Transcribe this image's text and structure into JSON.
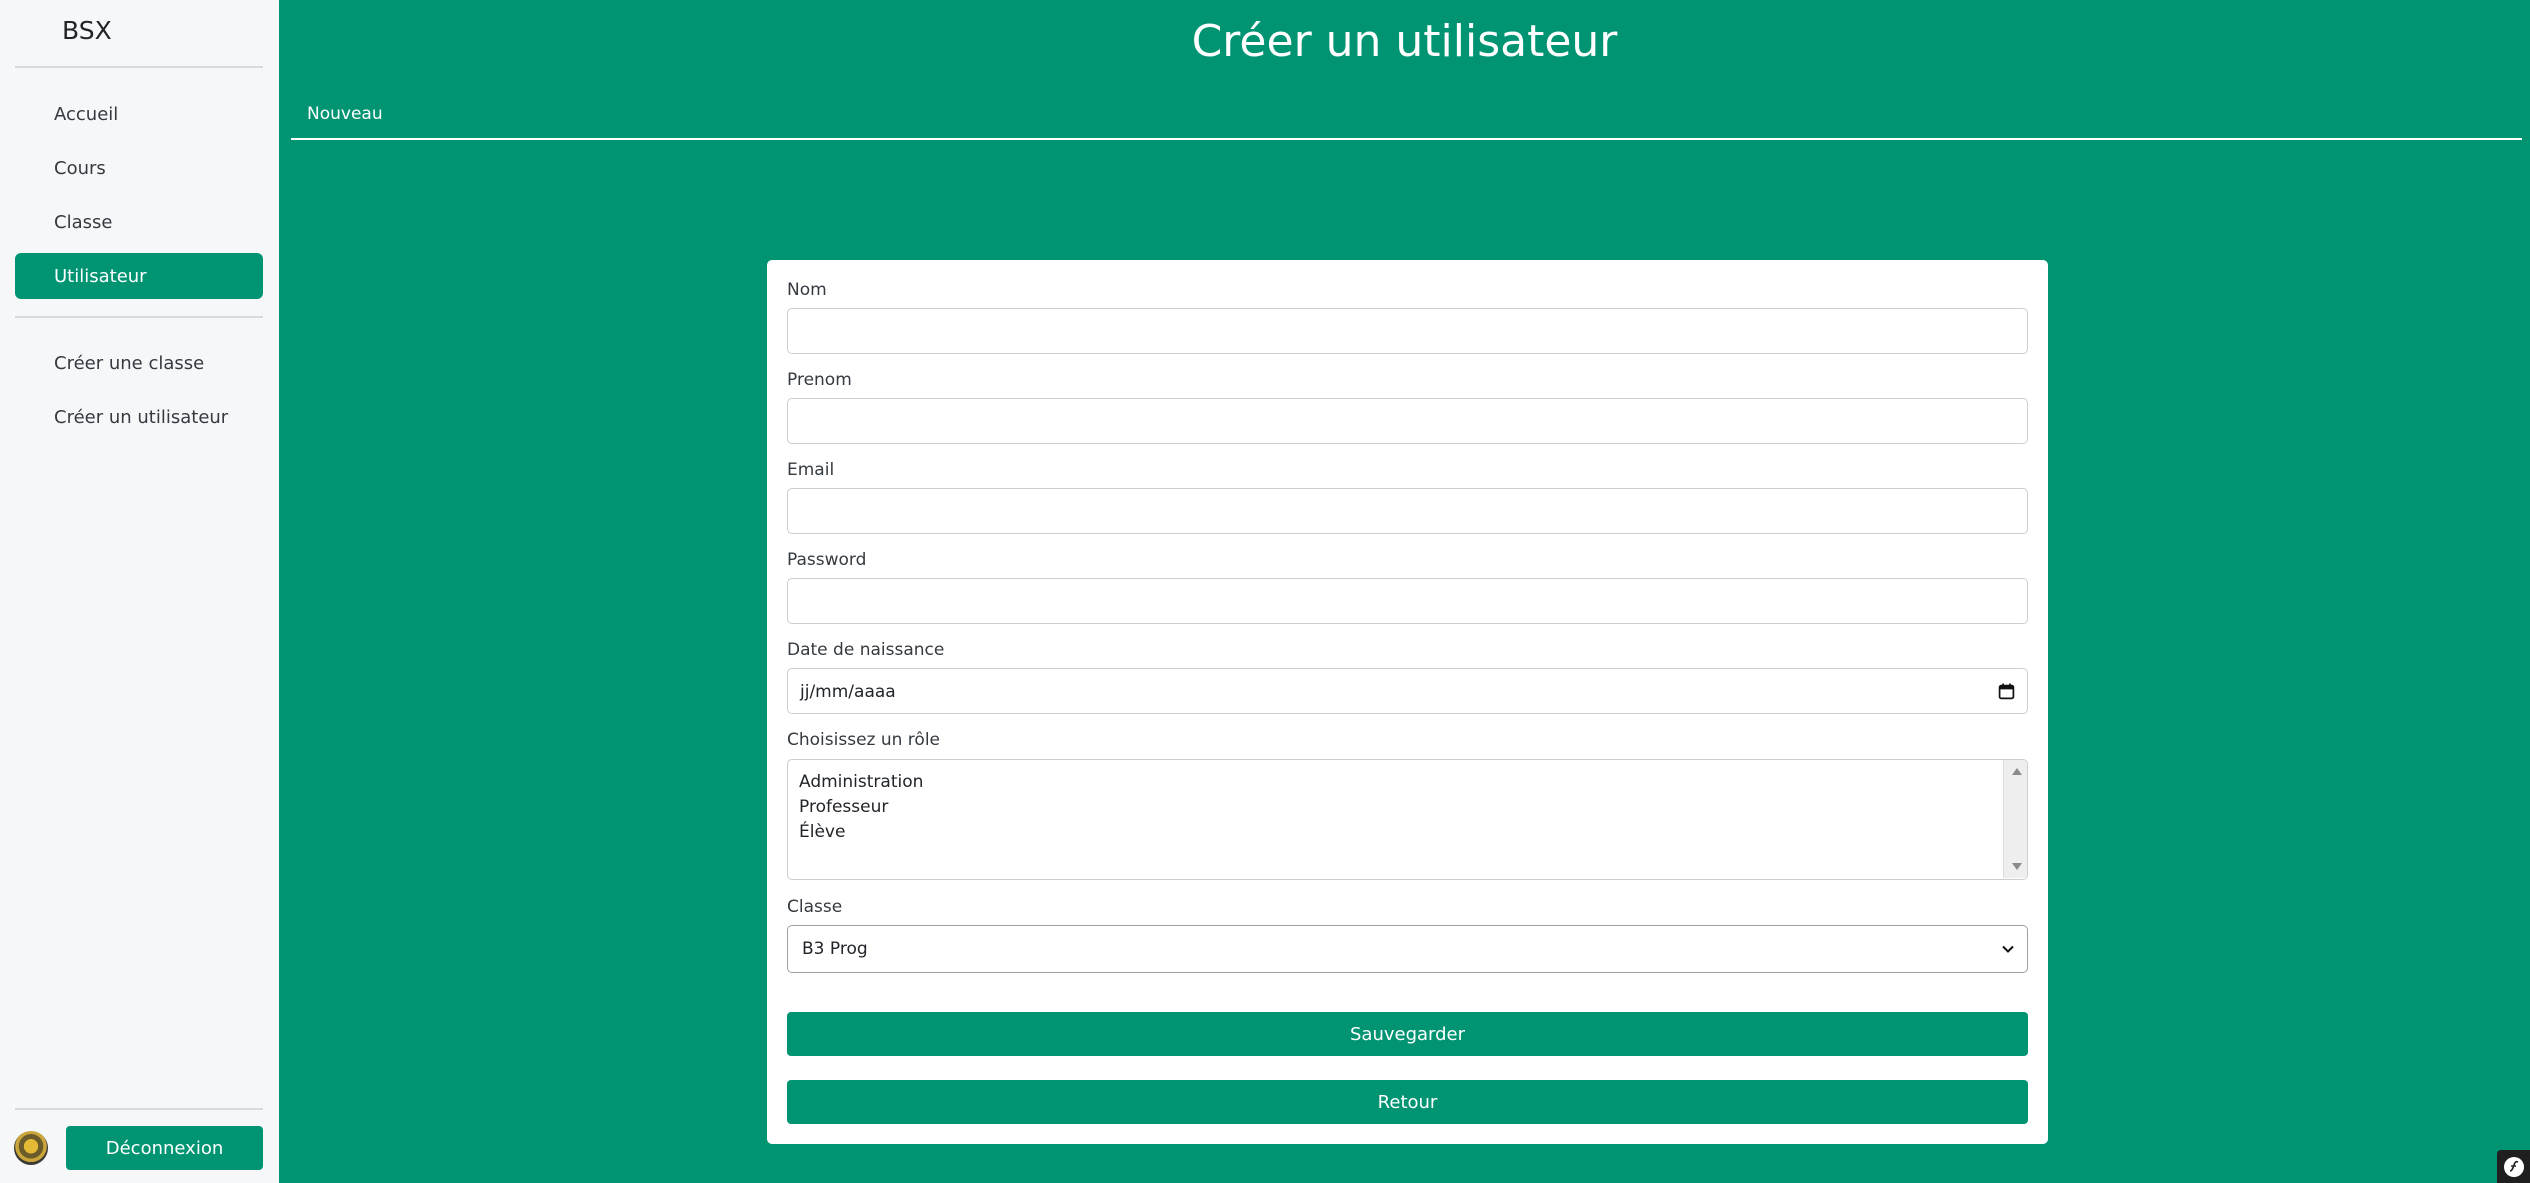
{
  "sidebar": {
    "brand": "BSX",
    "nav_items": [
      {
        "label": "Accueil",
        "active": false
      },
      {
        "label": "Cours",
        "active": false
      },
      {
        "label": "Classe",
        "active": false
      },
      {
        "label": "Utilisateur",
        "active": true
      }
    ],
    "create_items": [
      {
        "label": "Créer une classe"
      },
      {
        "label": "Créer un utilisateur"
      }
    ],
    "logout_label": "Déconnexion"
  },
  "header": {
    "title": "Créer un utilisateur",
    "tab_label": "Nouveau"
  },
  "form": {
    "nom": {
      "label": "Nom",
      "value": ""
    },
    "prenom": {
      "label": "Prenom",
      "value": ""
    },
    "email": {
      "label": "Email",
      "value": ""
    },
    "password": {
      "label": "Password",
      "value": ""
    },
    "birthdate": {
      "label": "Date de naissance",
      "placeholder": "jj/mm/aaaa"
    },
    "role": {
      "label": "Choisissez un rôle",
      "options": [
        "Administration",
        "Professeur",
        "Élève"
      ]
    },
    "classe": {
      "label": "Classe",
      "selected": "B3 Prog"
    },
    "save_label": "Sauvegarder",
    "back_label": "Retour"
  },
  "colors": {
    "primary": "#009473",
    "sidebar_bg": "#f6f7f9",
    "card_bg": "#ffffff"
  },
  "icons": {
    "date": "calendar-icon",
    "select": "chevron-down-icon",
    "toolbar": "symfony-icon"
  }
}
